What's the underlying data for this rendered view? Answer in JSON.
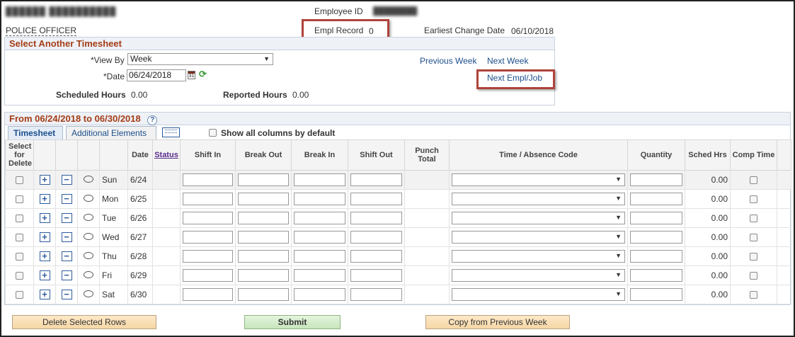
{
  "header": {
    "employee_id_label": "Employee ID",
    "empl_record_label": "Empl Record",
    "empl_record_value": "0",
    "earliest_change_label": "Earliest Change Date",
    "earliest_change_value": "06/10/2018",
    "job_title": "POLICE OFFICER"
  },
  "select_panel": {
    "title": "Select Another Timesheet",
    "view_by_label": "*View By",
    "view_by_value": "Week",
    "date_label": "*Date",
    "date_value": "06/24/2018",
    "previous_week": "Previous Week",
    "next_week": "Next Week",
    "next_empl_job": "Next Empl/Job",
    "scheduled_hours_label": "Scheduled Hours",
    "scheduled_hours_value": "0.00",
    "reported_hours_label": "Reported Hours",
    "reported_hours_value": "0.00"
  },
  "timesheet": {
    "range_title": "From 06/24/2018 to 06/30/2018",
    "help_icon": "?",
    "tabs": [
      "Timesheet",
      "Additional Elements"
    ],
    "show_all_label": "Show all columns by default",
    "columns": {
      "select": "Select for Delete",
      "date": "Date",
      "status": "Status",
      "shift_in": "Shift In",
      "break_out": "Break Out",
      "break_in": "Break In",
      "shift_out": "Shift Out",
      "punch_total": "Punch Total",
      "time_code": "Time / Absence Code",
      "quantity": "Quantity",
      "sched_hrs": "Sched Hrs",
      "comp_time": "Comp Time"
    },
    "rows": [
      {
        "day": "Sun",
        "date": "6/24",
        "sched": "0.00"
      },
      {
        "day": "Mon",
        "date": "6/25",
        "sched": "0.00"
      },
      {
        "day": "Tue",
        "date": "6/26",
        "sched": "0.00"
      },
      {
        "day": "Wed",
        "date": "6/27",
        "sched": "0.00"
      },
      {
        "day": "Thu",
        "date": "6/28",
        "sched": "0.00"
      },
      {
        "day": "Fri",
        "date": "6/29",
        "sched": "0.00"
      },
      {
        "day": "Sat",
        "date": "6/30",
        "sched": "0.00"
      }
    ],
    "add_symbol": "+",
    "remove_symbol": "−"
  },
  "buttons": {
    "delete_rows": "Delete Selected Rows",
    "submit": "Submit",
    "copy_previous": "Copy from Previous Week"
  },
  "icons": {
    "calendar": "calendar-icon",
    "refresh": "refresh-icon",
    "comment": "comment-icon",
    "grid_view": "grid-view-icon",
    "help": "help-icon"
  },
  "colors": {
    "highlight_box": "#b0433a",
    "section_title": "#a33d17",
    "link": "#1d4f8c"
  }
}
